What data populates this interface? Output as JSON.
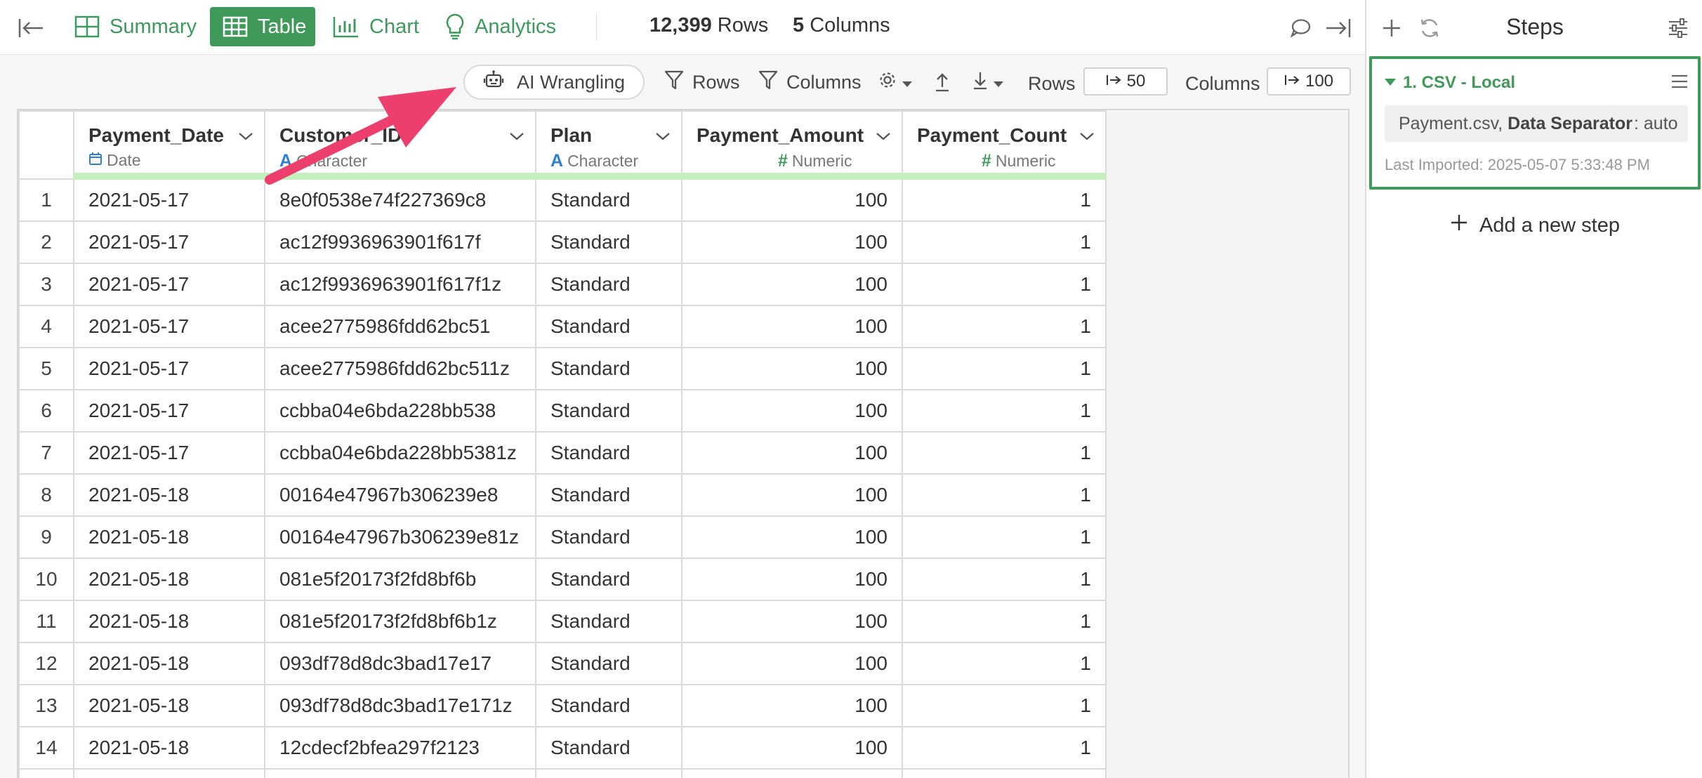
{
  "toolbar_top": {
    "tabs": [
      {
        "label": "Summary",
        "icon": "summary-grid-icon"
      },
      {
        "label": "Table",
        "icon": "table-icon",
        "active": true
      },
      {
        "label": "Chart",
        "icon": "bar-chart-icon"
      },
      {
        "label": "Analytics",
        "icon": "lightbulb-icon"
      }
    ],
    "rows_count": "12,399",
    "rows_label": "Rows",
    "cols_count": "5",
    "cols_label": "Columns"
  },
  "toolbar": {
    "ai_label": "AI Wrangling",
    "filter_rows_label": "Rows",
    "filter_cols_label": "Columns",
    "rows_label": "Rows",
    "rows_value": "50",
    "cols_label": "Columns",
    "cols_value": "100"
  },
  "table": {
    "columns": [
      {
        "name": "Payment_Date",
        "type": "Date",
        "icon": "calendar-icon"
      },
      {
        "name": "Customer_ID",
        "type": "Character",
        "icon": "character-a-icon"
      },
      {
        "name": "Plan",
        "type": "Character",
        "icon": "character-a-icon"
      },
      {
        "name": "Payment_Amount",
        "type": "Numeric",
        "icon": "hash-icon"
      },
      {
        "name": "Payment_Count",
        "type": "Numeric",
        "icon": "hash-icon"
      }
    ],
    "rows": [
      [
        "1",
        "2021-05-17",
        "8e0f0538e74f227369c8",
        "Standard",
        "100",
        "1"
      ],
      [
        "2",
        "2021-05-17",
        "ac12f9936963901f617f",
        "Standard",
        "100",
        "1"
      ],
      [
        "3",
        "2021-05-17",
        "ac12f9936963901f617f1z",
        "Standard",
        "100",
        "1"
      ],
      [
        "4",
        "2021-05-17",
        "acee2775986fdd62bc51",
        "Standard",
        "100",
        "1"
      ],
      [
        "5",
        "2021-05-17",
        "acee2775986fdd62bc511z",
        "Standard",
        "100",
        "1"
      ],
      [
        "6",
        "2021-05-17",
        "ccbba04e6bda228bb538",
        "Standard",
        "100",
        "1"
      ],
      [
        "7",
        "2021-05-17",
        "ccbba04e6bda228bb5381z",
        "Standard",
        "100",
        "1"
      ],
      [
        "8",
        "2021-05-18",
        "00164e47967b306239e8",
        "Standard",
        "100",
        "1"
      ],
      [
        "9",
        "2021-05-18",
        "00164e47967b306239e81z",
        "Standard",
        "100",
        "1"
      ],
      [
        "10",
        "2021-05-18",
        "081e5f20173f2fd8bf6b",
        "Standard",
        "100",
        "1"
      ],
      [
        "11",
        "2021-05-18",
        "081e5f20173f2fd8bf6b1z",
        "Standard",
        "100",
        "1"
      ],
      [
        "12",
        "2021-05-18",
        "093df78d8dc3bad17e17",
        "Standard",
        "100",
        "1"
      ],
      [
        "13",
        "2021-05-18",
        "093df78d8dc3bad17e171z",
        "Standard",
        "100",
        "1"
      ],
      [
        "14",
        "2021-05-18",
        "12cdecf2bfea297f2123",
        "Standard",
        "100",
        "1"
      ]
    ]
  },
  "steps": {
    "title": "Steps",
    "step1": {
      "name": "1. CSV - Local",
      "file": "Payment.csv,",
      "separator_label": "Data Separator",
      "separator_value": ": auto",
      "last_imported": "Last Imported: 2025-05-07 5:33:48 PM"
    },
    "add_label": "Add a new step"
  },
  "colors": {
    "accent": "#3f9a59",
    "annotation_arrow": "#ec3f6e",
    "header_bar": "#c4efbe",
    "char_type": "#2f7fd1"
  }
}
